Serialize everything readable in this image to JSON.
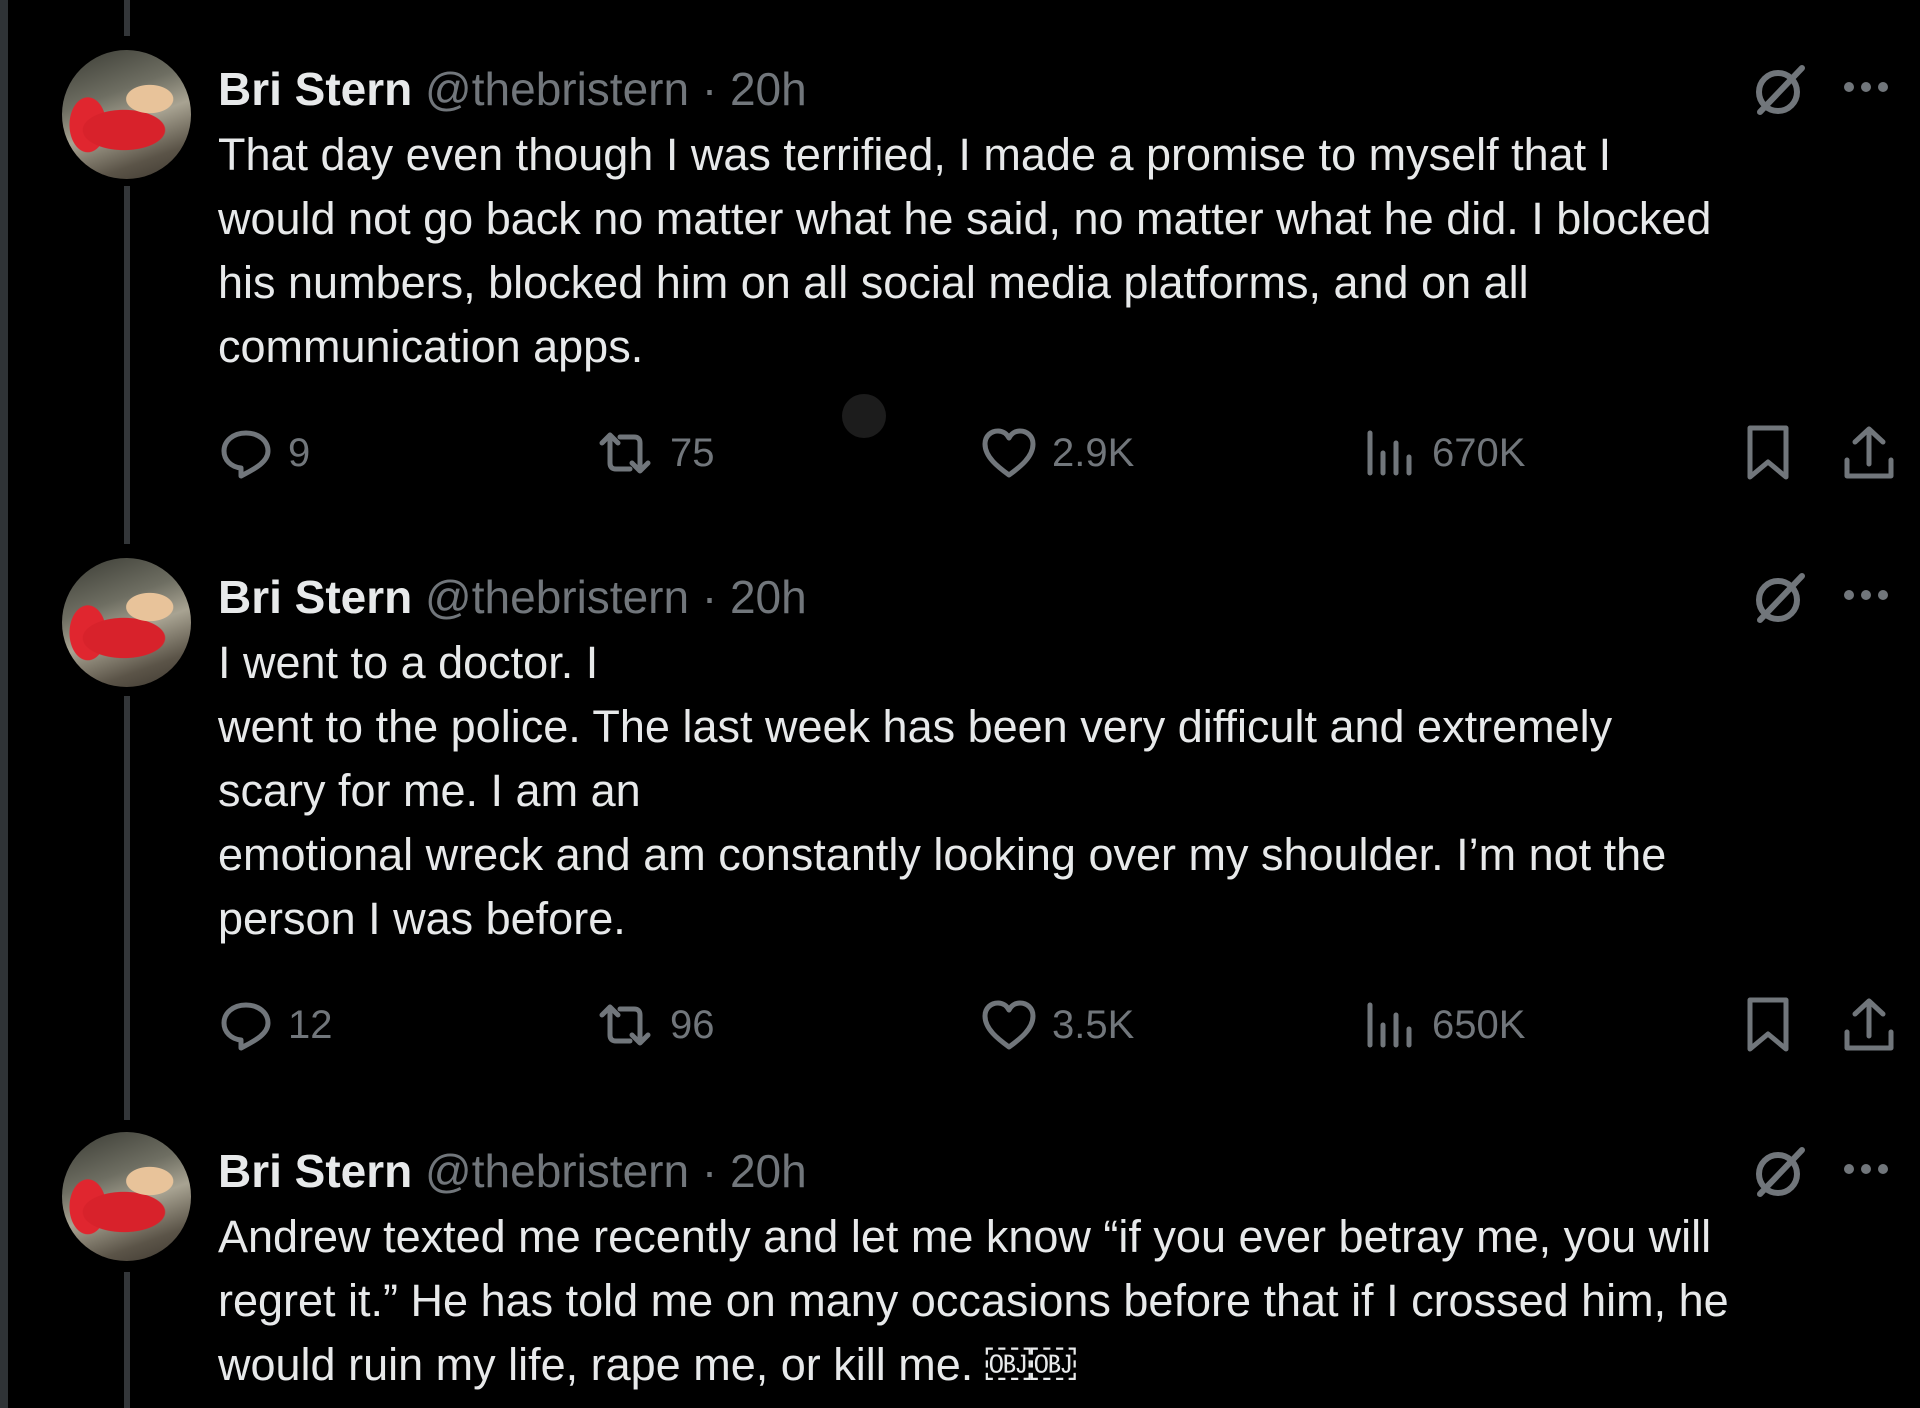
{
  "tweets": [
    {
      "name": "Bri Stern",
      "handle": "@thebristern",
      "time": "· 20h",
      "text": "That day even though I was terrified, I made a promise to myself that I\nwould not go back no matter what he said, no matter what he did. I blocked\nhis numbers, blocked him on all social media platforms, and on all\ncommunication apps.",
      "replies": "9",
      "reposts": "75",
      "likes": "2.9K",
      "views": "670K"
    },
    {
      "name": "Bri Stern",
      "handle": "@thebristern",
      "time": "· 20h",
      "text": "I went to a doctor. I\nwent to the police. The last week has been very difficult and extremely\nscary for me. I am an\nemotional wreck and am constantly looking over my shoulder. I’m not the\nperson I was before.",
      "replies": "12",
      "reposts": "96",
      "likes": "3.5K",
      "views": "650K"
    },
    {
      "name": "Bri Stern",
      "handle": "@thebristern",
      "time": "· 20h",
      "text": "Andrew texted me recently and let me know “if you ever betray me, you will\nregret it.” He has told me on many occasions before that if I crossed him, he\nwould ruin my life, rape me, or kill me. ￼￼"
    }
  ],
  "icons": {
    "reply": "speech-bubble-icon",
    "repost": "repost-arrows-icon",
    "like": "heart-icon",
    "views": "bar-chart-icon",
    "bookmark": "bookmark-icon",
    "share": "share-upload-icon",
    "grok": "grok-slash-circle-icon",
    "more": "ellipsis-icon"
  },
  "colors": {
    "background": "#000000",
    "text": "#e7e9ea",
    "muted": "#71767b",
    "thread_line": "#333639"
  }
}
